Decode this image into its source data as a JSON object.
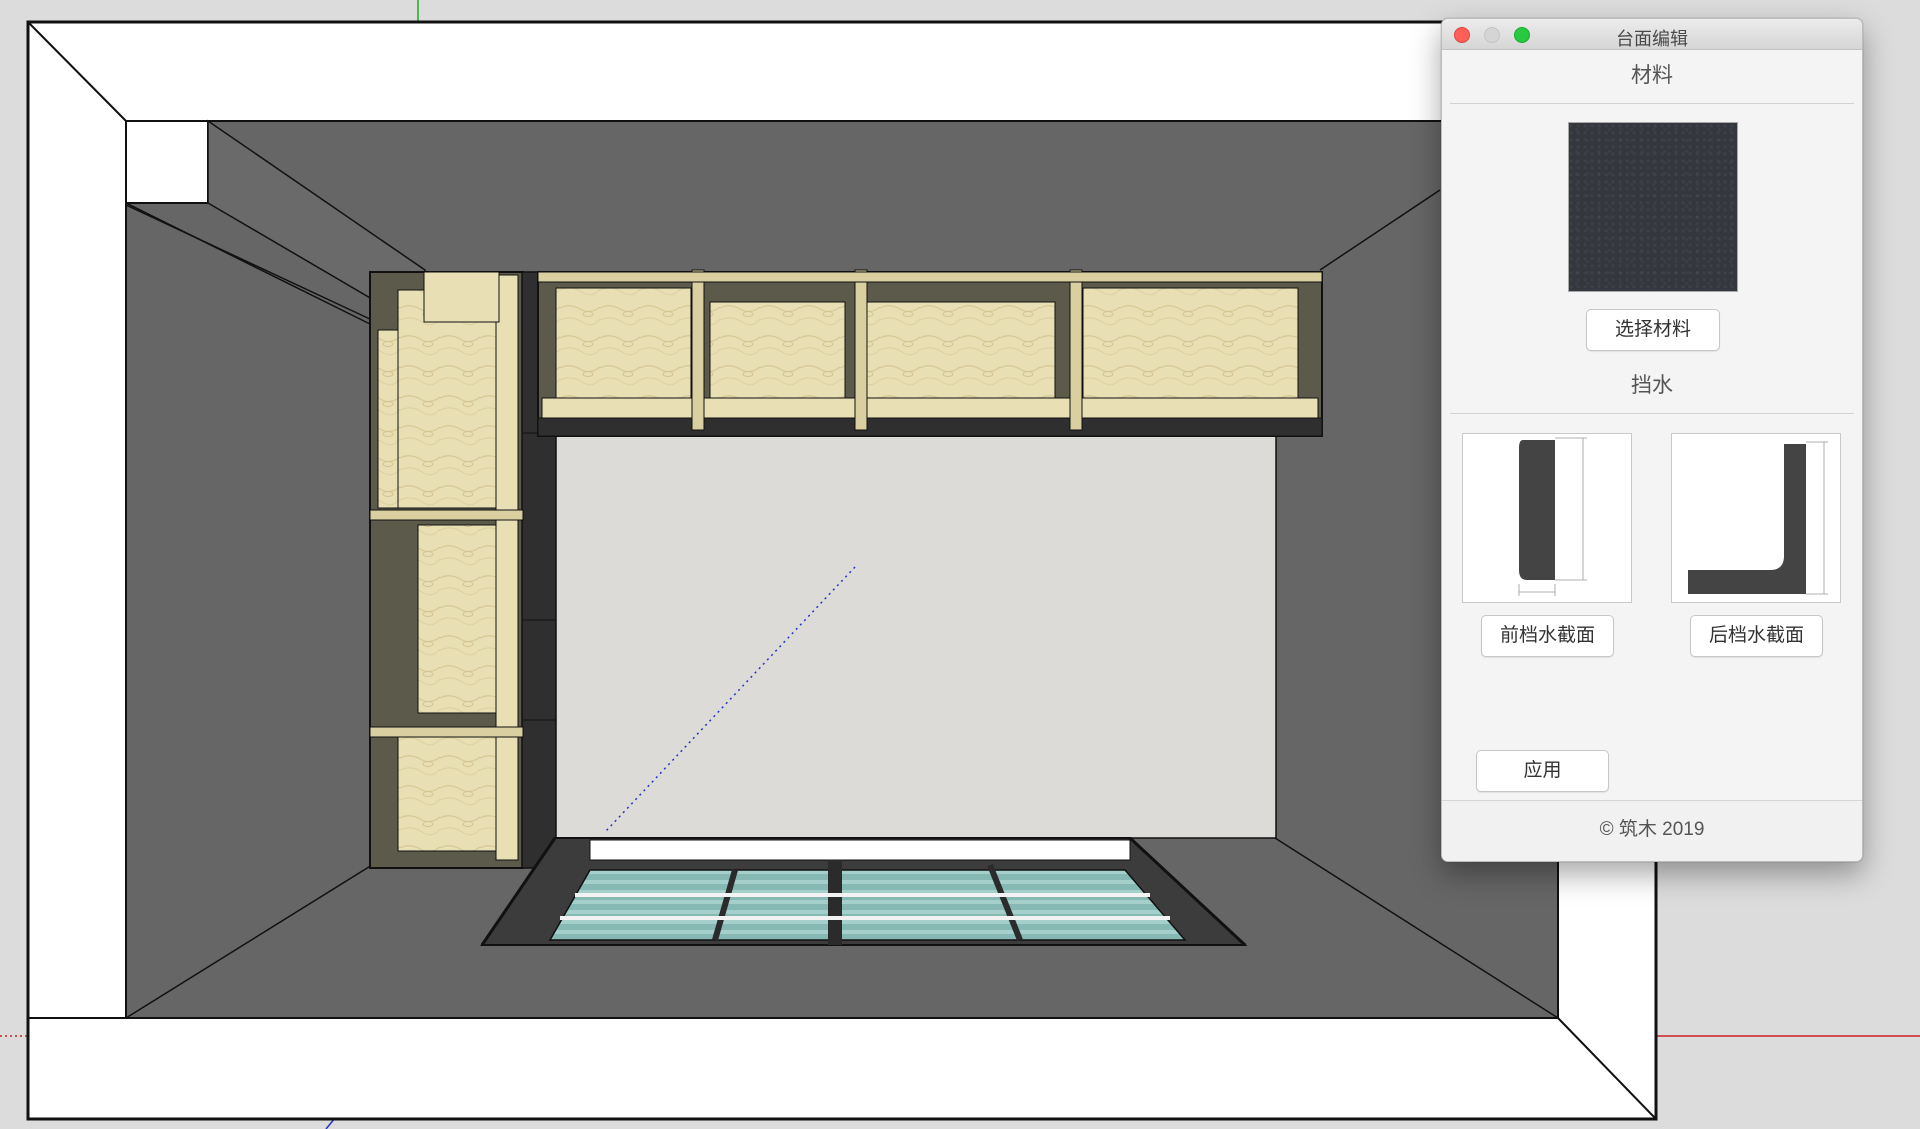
{
  "panel": {
    "title": "台面编辑",
    "material_section": "材料",
    "select_material_button": "选择材料",
    "backsplash_section": "挡水",
    "front_section_button": "前档水截面",
    "back_section_button": "后档水截面",
    "apply_button": "应用",
    "footer": "© 筑木 2019"
  },
  "colors": {
    "floor": "#666666",
    "room_wall": "#ffffff",
    "countertop_material": "#35373f",
    "wood": "#e9dfb4",
    "cabinet_frame": "#5c5a4a",
    "window_glass": "#7fb3ae"
  }
}
